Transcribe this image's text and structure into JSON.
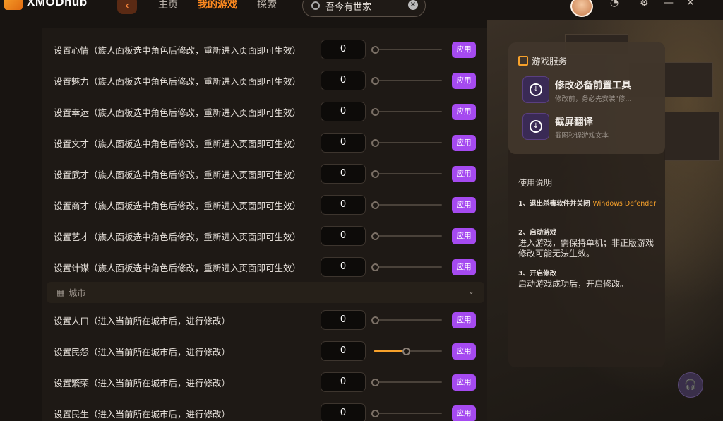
{
  "app": {
    "logo_text": "XMODhub"
  },
  "nav": {
    "back_icon": "back-arrow-icon",
    "tabs": [
      {
        "label": "主页",
        "active": false
      },
      {
        "label": "我的游戏",
        "active": true
      },
      {
        "label": "探索",
        "active": false
      }
    ]
  },
  "search": {
    "value": "吾今有世家",
    "clear_label": "×"
  },
  "top_icons": [
    "avatar",
    "notification-icon",
    "settings-icon",
    "minimize-icon",
    "close-icon"
  ],
  "rows": [
    {
      "label": "设置心情（族人面板选中角色后修改，重新进入页面即可生效）",
      "value": "0",
      "slider_level": 0,
      "apply": "应用"
    },
    {
      "label": "设置魅力（族人面板选中角色后修改，重新进入页面即可生效）",
      "value": "0",
      "slider_level": 0,
      "apply": "应用"
    },
    {
      "label": "设置幸运（族人面板选中角色后修改，重新进入页面即可生效）",
      "value": "0",
      "slider_level": 0,
      "apply": "应用"
    },
    {
      "label": "设置文才（族人面板选中角色后修改，重新进入页面即可生效）",
      "value": "0",
      "slider_level": 0,
      "apply": "应用"
    },
    {
      "label": "设置武才（族人面板选中角色后修改，重新进入页面即可生效）",
      "value": "0",
      "slider_level": 0,
      "apply": "应用"
    },
    {
      "label": "设置商才（族人面板选中角色后修改，重新进入页面即可生效）",
      "value": "0",
      "slider_level": 0,
      "apply": "应用"
    },
    {
      "label": "设置艺才（族人面板选中角色后修改，重新进入页面即可生效）",
      "value": "0",
      "slider_level": 0,
      "apply": "应用"
    },
    {
      "label": "设置计谋（族人面板选中角色后修改，重新进入页面即可生效）",
      "value": "0",
      "slider_level": 0,
      "apply": "应用"
    }
  ],
  "section": {
    "label": "城市"
  },
  "city_rows": [
    {
      "label": "设置人口（进入当前所在城市后，进行修改）",
      "value": "0",
      "slider_level": 0,
      "apply": "应用"
    },
    {
      "label": "设置民怨（进入当前所在城市后，进行修改）",
      "value": "0",
      "slider_level": 0.5,
      "apply": "应用"
    },
    {
      "label": "设置繁荣（进入当前所在城市后，进行修改）",
      "value": "0",
      "slider_level": 0,
      "apply": "应用"
    },
    {
      "label": "设置民生（进入当前所在城市后，进行修改）",
      "value": "0",
      "slider_level": 0,
      "apply": "应用"
    }
  ],
  "sidebar": {
    "services_title": "游戏服务",
    "services": [
      {
        "name": "修改必备前置工具",
        "desc": "修改前，务必先安装\"修..."
      },
      {
        "name": "截屏翻译",
        "desc": "截图秒译游戏文本"
      }
    ],
    "help_title": "使用说明",
    "help": [
      {
        "step": "1、退出杀毒软件并关闭",
        "accent": "Windows Defender",
        "text": ""
      },
      {
        "step": "2、启动游戏",
        "accent": "",
        "text": "进入游戏，需保持单机；非正版游戏修改可能无法生效。"
      },
      {
        "step": "3、开启修改",
        "accent": "",
        "text": "启动游戏成功后，开启修改。"
      }
    ]
  },
  "colors": {
    "accent": "#ff8a1f",
    "apply_button": "#a54af0",
    "slider_fill": "#f7a12b",
    "background": "#181411"
  }
}
